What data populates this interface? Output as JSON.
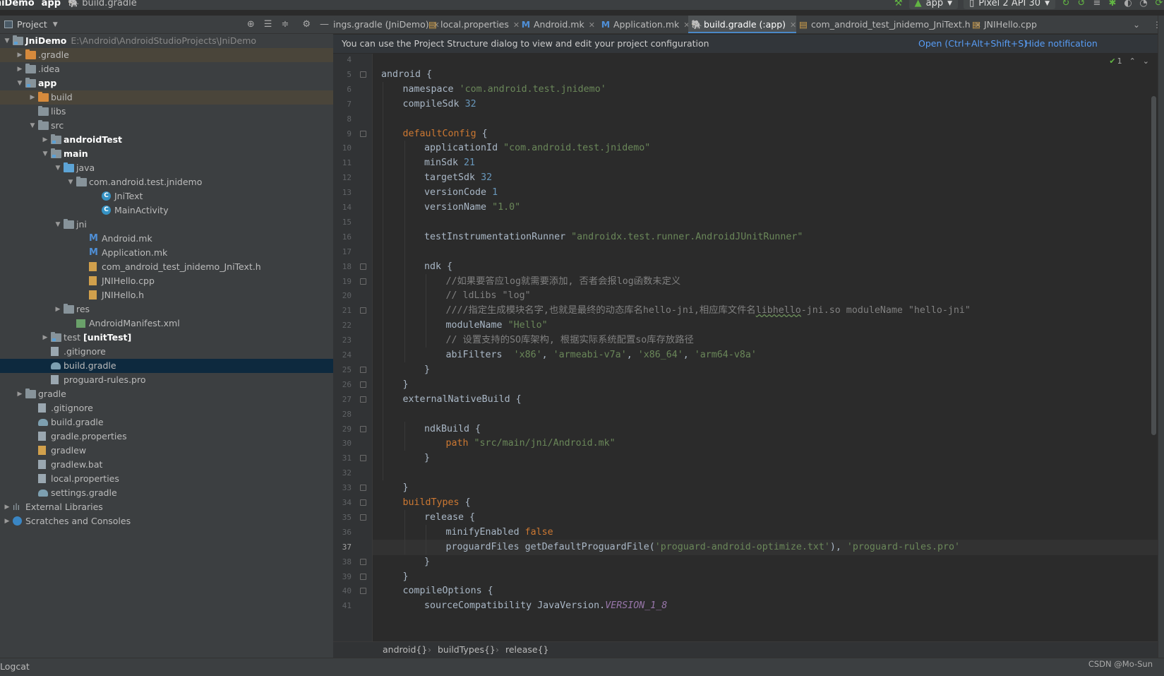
{
  "navbar": {
    "project": "JniDemo",
    "module": "app",
    "file": "build.gradle",
    "run_config": "app",
    "device": "Pixel 2 API 30"
  },
  "project_panel": {
    "title": "Project",
    "tree": [
      {
        "label": "JniDemo",
        "path": "E:\\Android\\AndroidStudioProjects\\JniDemo",
        "depth": 0,
        "arrow": "open",
        "icon": "module",
        "bold": true
      },
      {
        "label": ".gradle",
        "depth": 1,
        "arrow": "closed",
        "icon": "folder-orange",
        "excluded": true
      },
      {
        "label": ".idea",
        "depth": 1,
        "arrow": "closed",
        "icon": "folder"
      },
      {
        "label": "app",
        "depth": 1,
        "arrow": "open",
        "icon": "module",
        "bold": true
      },
      {
        "label": "build",
        "depth": 2,
        "arrow": "closed",
        "icon": "folder-orange",
        "excluded": true
      },
      {
        "label": "libs",
        "depth": 2,
        "arrow": "none",
        "icon": "folder"
      },
      {
        "label": "src",
        "depth": 2,
        "arrow": "open",
        "icon": "folder"
      },
      {
        "label": "androidTest",
        "depth": 3,
        "arrow": "closed",
        "icon": "module",
        "bold": true
      },
      {
        "label": "main",
        "depth": 3,
        "arrow": "open",
        "icon": "module",
        "bold": true
      },
      {
        "label": "java",
        "depth": 4,
        "arrow": "open",
        "icon": "folder-blue"
      },
      {
        "label": "com.android.test.jnidemo",
        "depth": 5,
        "arrow": "open",
        "icon": "folder"
      },
      {
        "label": "JniText",
        "depth": 7,
        "arrow": "none",
        "icon": "class"
      },
      {
        "label": "MainActivity",
        "depth": 7,
        "arrow": "none",
        "icon": "class"
      },
      {
        "label": "jni",
        "depth": 4,
        "arrow": "open",
        "icon": "folder"
      },
      {
        "label": "Android.mk",
        "depth": 6,
        "arrow": "none",
        "icon": "mk"
      },
      {
        "label": "Application.mk",
        "depth": 6,
        "arrow": "none",
        "icon": "mk"
      },
      {
        "label": "com_android_test_jnidemo_JniText.h",
        "depth": 6,
        "arrow": "none",
        "icon": "header"
      },
      {
        "label": "JNIHello.cpp",
        "depth": 6,
        "arrow": "none",
        "icon": "header"
      },
      {
        "label": "JNIHello.h",
        "depth": 6,
        "arrow": "none",
        "icon": "header"
      },
      {
        "label": "res",
        "depth": 4,
        "arrow": "closed",
        "icon": "folder"
      },
      {
        "label": "AndroidManifest.xml",
        "depth": 5,
        "arrow": "none",
        "icon": "manifest"
      },
      {
        "label": "test [unitTest]",
        "depth": 3,
        "arrow": "closed",
        "icon": "module",
        "bold_suffix": "[unitTest]"
      },
      {
        "label": ".gitignore",
        "depth": 3,
        "arrow": "none",
        "icon": "text"
      },
      {
        "label": "build.gradle",
        "depth": 3,
        "arrow": "none",
        "icon": "gradle",
        "selected": true
      },
      {
        "label": "proguard-rules.pro",
        "depth": 3,
        "arrow": "none",
        "icon": "text"
      },
      {
        "label": "gradle",
        "depth": 1,
        "arrow": "closed",
        "icon": "folder"
      },
      {
        "label": ".gitignore",
        "depth": 2,
        "arrow": "none",
        "icon": "text"
      },
      {
        "label": "build.gradle",
        "depth": 2,
        "arrow": "none",
        "icon": "gradle"
      },
      {
        "label": "gradle.properties",
        "depth": 2,
        "arrow": "none",
        "icon": "text"
      },
      {
        "label": "gradlew",
        "depth": 2,
        "arrow": "none",
        "icon": "text-orange"
      },
      {
        "label": "gradlew.bat",
        "depth": 2,
        "arrow": "none",
        "icon": "text"
      },
      {
        "label": "local.properties",
        "depth": 2,
        "arrow": "none",
        "icon": "text"
      },
      {
        "label": "settings.gradle",
        "depth": 2,
        "arrow": "none",
        "icon": "gradle"
      },
      {
        "label": "External Libraries",
        "depth": 0,
        "arrow": "closed",
        "icon": "libs"
      },
      {
        "label": "Scratches and Consoles",
        "depth": 0,
        "arrow": "closed",
        "icon": "scratch"
      }
    ]
  },
  "tabs": [
    {
      "label": "ings.gradle (JniDemo)",
      "icon": "gradle-icon",
      "active": false
    },
    {
      "label": "local.properties",
      "icon": "properties-icon",
      "active": false
    },
    {
      "label": "Android.mk",
      "icon": "mk-icon",
      "active": false
    },
    {
      "label": "Application.mk",
      "icon": "mk-icon",
      "active": false
    },
    {
      "label": "build.gradle (:app)",
      "icon": "gradle-icon",
      "active": true
    },
    {
      "label": "com_android_test_jnidemo_JniText.h",
      "icon": "header-icon",
      "active": false
    },
    {
      "label": "JNIHello.cpp",
      "icon": "cpp-icon",
      "active": false
    }
  ],
  "banner": {
    "message": "You can use the Project Structure dialog to view and edit your project configuration",
    "open_link": "Open (Ctrl+Alt+Shift+S)",
    "hide_link": "Hide notification"
  },
  "editor": {
    "inspection_count": "1",
    "current_line": 37,
    "lines": [
      {
        "n": 4,
        "indent": 0,
        "tokens": []
      },
      {
        "n": 5,
        "indent": 0,
        "fold": true,
        "tokens": [
          [
            "t",
            "android {"
          ]
        ]
      },
      {
        "n": 6,
        "indent": 1,
        "tokens": [
          [
            "t",
            "namespace "
          ],
          [
            "s",
            "'com.android.test.jnidemo'"
          ]
        ]
      },
      {
        "n": 7,
        "indent": 1,
        "tokens": [
          [
            "t",
            "compileSdk "
          ],
          [
            "n",
            "32"
          ]
        ]
      },
      {
        "n": 8,
        "indent": 0,
        "tokens": []
      },
      {
        "n": 9,
        "indent": 1,
        "fold": true,
        "tokens": [
          [
            "k",
            "defaultConfig"
          ],
          [
            "t",
            " {"
          ]
        ]
      },
      {
        "n": 10,
        "indent": 2,
        "tokens": [
          [
            "t",
            "applicationId "
          ],
          [
            "s",
            "\"com.android.test.jnidemo\""
          ]
        ]
      },
      {
        "n": 11,
        "indent": 2,
        "tokens": [
          [
            "t",
            "minSdk "
          ],
          [
            "n",
            "21"
          ]
        ]
      },
      {
        "n": 12,
        "indent": 2,
        "tokens": [
          [
            "t",
            "targetSdk "
          ],
          [
            "n",
            "32"
          ]
        ]
      },
      {
        "n": 13,
        "indent": 2,
        "tokens": [
          [
            "t",
            "versionCode "
          ],
          [
            "n",
            "1"
          ]
        ]
      },
      {
        "n": 14,
        "indent": 2,
        "tokens": [
          [
            "t",
            "versionName "
          ],
          [
            "s",
            "\"1.0\""
          ]
        ]
      },
      {
        "n": 15,
        "indent": 0,
        "tokens": []
      },
      {
        "n": 16,
        "indent": 2,
        "tokens": [
          [
            "t",
            "testInstrumentationRunner "
          ],
          [
            "s",
            "\"androidx.test.runner.AndroidJUnitRunner\""
          ]
        ]
      },
      {
        "n": 17,
        "indent": 0,
        "tokens": []
      },
      {
        "n": 18,
        "indent": 2,
        "fold": true,
        "tokens": [
          [
            "t",
            "ndk {"
          ]
        ]
      },
      {
        "n": 19,
        "indent": 3,
        "fold": true,
        "tokens": [
          [
            "c",
            "//如果要答应log就需要添加, 否者会报log函数未定义"
          ]
        ]
      },
      {
        "n": 20,
        "indent": 3,
        "tokens": [
          [
            "c",
            "// ldLibs \"log\""
          ]
        ]
      },
      {
        "n": 21,
        "indent": 3,
        "fold": true,
        "tokens": [
          [
            "c",
            "////指定生成模块名字,也就是最终的动态库名hello-jni,相应库文件名"
          ],
          [
            "cu",
            "libhello"
          ],
          [
            "c",
            "-jni.so moduleName \"hello-jni\""
          ]
        ]
      },
      {
        "n": 22,
        "indent": 3,
        "tokens": [
          [
            "t",
            "moduleName "
          ],
          [
            "s",
            "\"Hello\""
          ]
        ]
      },
      {
        "n": 23,
        "indent": 3,
        "tokens": [
          [
            "c",
            "// 设置支持的SO库架构, 根据实际系统配置so库存放路径"
          ]
        ]
      },
      {
        "n": 24,
        "indent": 3,
        "tokens": [
          [
            "t",
            "abiFilters  "
          ],
          [
            "s",
            "'x86'"
          ],
          [
            "t",
            ", "
          ],
          [
            "s",
            "'armeabi-v7a'"
          ],
          [
            "t",
            ", "
          ],
          [
            "s",
            "'x86_64'"
          ],
          [
            "t",
            ", "
          ],
          [
            "s",
            "'arm64-v8a'"
          ]
        ]
      },
      {
        "n": 25,
        "indent": 2,
        "fold": true,
        "tokens": [
          [
            "t",
            "}"
          ]
        ]
      },
      {
        "n": 26,
        "indent": 1,
        "fold": true,
        "tokens": [
          [
            "t",
            "}"
          ]
        ]
      },
      {
        "n": 27,
        "indent": 1,
        "fold": true,
        "tokens": [
          [
            "t",
            "externalNativeBuild {"
          ]
        ]
      },
      {
        "n": 28,
        "indent": 0,
        "tokens": []
      },
      {
        "n": 29,
        "indent": 2,
        "fold": true,
        "tokens": [
          [
            "t",
            "ndkBuild {"
          ]
        ]
      },
      {
        "n": 30,
        "indent": 3,
        "tokens": [
          [
            "k",
            "path"
          ],
          [
            "t",
            " "
          ],
          [
            "s",
            "\"src/main/jni/Android.mk\""
          ]
        ]
      },
      {
        "n": 31,
        "indent": 2,
        "fold": true,
        "tokens": [
          [
            "t",
            "}"
          ]
        ]
      },
      {
        "n": 32,
        "indent": 0,
        "tokens": []
      },
      {
        "n": 33,
        "indent": 1,
        "fold": true,
        "tokens": [
          [
            "t",
            "}"
          ]
        ]
      },
      {
        "n": 34,
        "indent": 1,
        "fold": true,
        "tokens": [
          [
            "k",
            "buildTypes"
          ],
          [
            "t",
            " {"
          ]
        ]
      },
      {
        "n": 35,
        "indent": 2,
        "fold": true,
        "tokens": [
          [
            "t",
            "release {"
          ]
        ]
      },
      {
        "n": 36,
        "indent": 3,
        "tokens": [
          [
            "t",
            "minifyEnabled "
          ],
          [
            "kw",
            "false"
          ]
        ]
      },
      {
        "n": 37,
        "indent": 3,
        "tokens": [
          [
            "t",
            "proguardFiles getDefaultProguardFile("
          ],
          [
            "s",
            "'proguard-android-optimize.txt'"
          ],
          [
            "t",
            "), "
          ],
          [
            "s",
            "'proguard-rules.pro'"
          ]
        ]
      },
      {
        "n": 38,
        "indent": 2,
        "fold": true,
        "tokens": [
          [
            "t",
            "}"
          ]
        ]
      },
      {
        "n": 39,
        "indent": 1,
        "fold": true,
        "tokens": [
          [
            "t",
            "}"
          ]
        ]
      },
      {
        "n": 40,
        "indent": 1,
        "fold": true,
        "tokens": [
          [
            "t",
            "compileOptions {"
          ]
        ]
      },
      {
        "n": 41,
        "indent": 2,
        "tokens": [
          [
            "t",
            "sourceCompatibility JavaVersion."
          ],
          [
            "v",
            "VERSION_1_8"
          ]
        ]
      }
    ]
  },
  "editor_breadcrumb": [
    "android{}",
    "buildTypes{}",
    "release{}"
  ],
  "statusbar": {
    "logcat": "Logcat",
    "watermark": "CSDN @Mo-Sun"
  }
}
